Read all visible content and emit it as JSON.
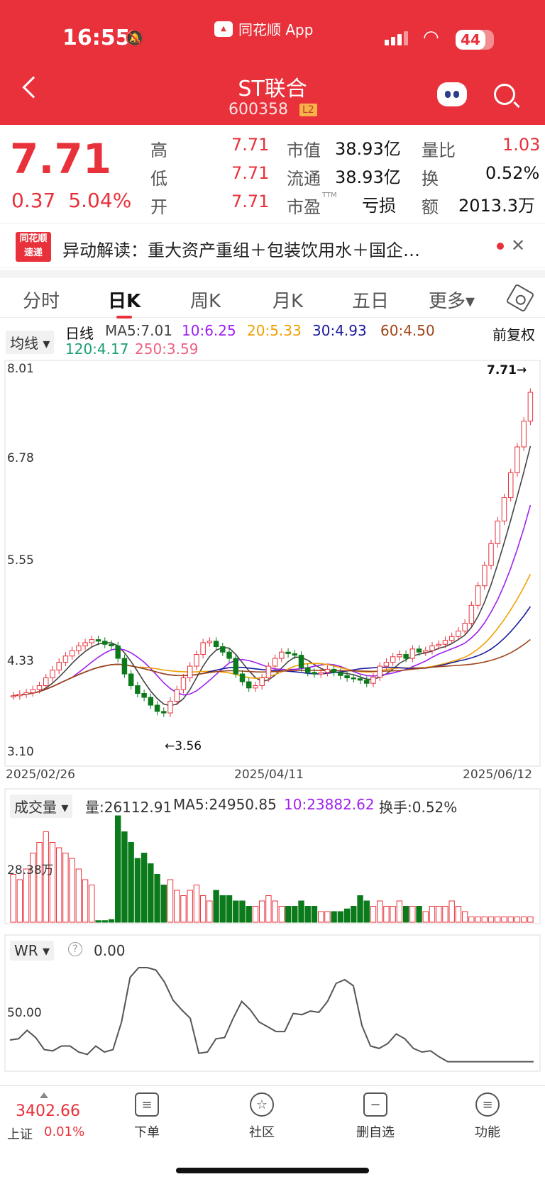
{
  "status_bar": {
    "time": "16:55",
    "app_name": "同花顺 App",
    "battery": "44"
  },
  "header": {
    "title": "ST联合",
    "code": "600358",
    "badge": "L2"
  },
  "quote": {
    "price": "7.71",
    "change": "0.37",
    "change_pct": "5.04%",
    "high_label": "高",
    "high": "7.71",
    "low_label": "低",
    "low": "7.71",
    "open_label": "开",
    "open": "7.71",
    "mcap_label": "市值",
    "mcap": "38.93亿",
    "float_label": "流通",
    "float": "38.93亿",
    "pe_label": "市盈",
    "pe_sup": "TTM",
    "pe": "亏损",
    "vr_label": "量比",
    "vr": "1.03",
    "turn_label": "换",
    "turn": "0.52%",
    "amt_label": "额",
    "amt": "2013.3万"
  },
  "news": {
    "logo_top": "同花顺",
    "logo_bottom": "速递",
    "text": "异动解读：重大资产重组＋包装饮用水＋国企…"
  },
  "tabs": [
    "分时",
    "日K",
    "周K",
    "月K",
    "五日",
    "更多▾"
  ],
  "kline_legend": {
    "dropdown": "均线 ▾",
    "kind": "日线",
    "ma5": "MA5:7.01",
    "ma10": "10:6.25",
    "ma20": "20:5.33",
    "ma30": "30:4.93",
    "ma60": "60:4.50",
    "ma120": "120:4.17",
    "ma250": "250:3.59",
    "adjust": "前复权",
    "colors": {
      "ma5": "#444444",
      "ma10": "#a020f0",
      "ma20": "#f0a000",
      "ma30": "#1a1aa0",
      "ma60": "#a0461a",
      "ma120": "#1aa070",
      "ma250": "#f06080"
    }
  },
  "kline_axis": {
    "y1": "8.01",
    "y2": "6.78",
    "y3": "5.55",
    "y4": "4.33",
    "y5": "3.10",
    "max_label": "7.71→",
    "min_label": "←3.56"
  },
  "dates": [
    "2025/02/26",
    "2025/04/11",
    "2025/06/12"
  ],
  "volume_legend": {
    "dropdown": "成交量 ▾",
    "vol": "量:26112.91",
    "ma5": "MA5:24950.85",
    "ma10": "10:23882.62",
    "turnover": "换手:0.52%",
    "axis": "28.38万"
  },
  "wr_legend": {
    "dropdown": "WR ▾",
    "help": "?",
    "value": "0.00",
    "axis": "50.00"
  },
  "chart_data": {
    "type": "candlestick",
    "title": "",
    "ylim": [
      3.1,
      8.01
    ],
    "closes": [
      3.82,
      3.84,
      3.86,
      3.9,
      3.95,
      4.05,
      4.15,
      4.25,
      4.33,
      4.4,
      4.46,
      4.5,
      4.54,
      4.52,
      4.48,
      4.46,
      4.3,
      4.1,
      3.95,
      3.85,
      3.8,
      3.7,
      3.62,
      3.6,
      3.75,
      3.9,
      4.05,
      4.2,
      4.35,
      4.5,
      4.52,
      4.45,
      4.38,
      4.3,
      4.1,
      4.0,
      3.92,
      3.95,
      4.05,
      4.2,
      4.3,
      4.38,
      4.36,
      4.34,
      4.18,
      4.12,
      4.1,
      4.12,
      4.16,
      4.12,
      4.08,
      4.05,
      4.04,
      4.02,
      3.98,
      4.06,
      4.2,
      4.25,
      4.32,
      4.35,
      4.3,
      4.42,
      4.38,
      4.4,
      4.46,
      4.48,
      4.53,
      4.58,
      4.65,
      4.75,
      4.98,
      5.23,
      5.49,
      5.77,
      6.06,
      6.36,
      6.68,
      7.01,
      7.34,
      7.71
    ],
    "volume": [
      9,
      8,
      10,
      13,
      15,
      17,
      15,
      14,
      13,
      12,
      10,
      8,
      7,
      0.3,
      0.3,
      0.5,
      20,
      17,
      15,
      12,
      13,
      11,
      9,
      7,
      8,
      6,
      5,
      6,
      7,
      5,
      4,
      6,
      5,
      5,
      4,
      4,
      3,
      3,
      4,
      5,
      4,
      3,
      3,
      3,
      4,
      3,
      3,
      2,
      2,
      2,
      2,
      2.5,
      3,
      5,
      4,
      3,
      4,
      3,
      3,
      4,
      3,
      3,
      3,
      2,
      3,
      3,
      3,
      4,
      3,
      2,
      1,
      1,
      1,
      1,
      1,
      1,
      1,
      1,
      1,
      1
    ],
    "wr": [
      20,
      21,
      28,
      22,
      12,
      11,
      15,
      15,
      10,
      8,
      15,
      10,
      12,
      35,
      72,
      80,
      80,
      78,
      68,
      53,
      45,
      38,
      9,
      10,
      21,
      22,
      38,
      52,
      45,
      35,
      31,
      27,
      27,
      42,
      41,
      44,
      43,
      52,
      67,
      70,
      65,
      32,
      15,
      13,
      17,
      25,
      21,
      13,
      10,
      11,
      6,
      2,
      2,
      2,
      2,
      2,
      2,
      2,
      2,
      2,
      2,
      2
    ]
  }
}
